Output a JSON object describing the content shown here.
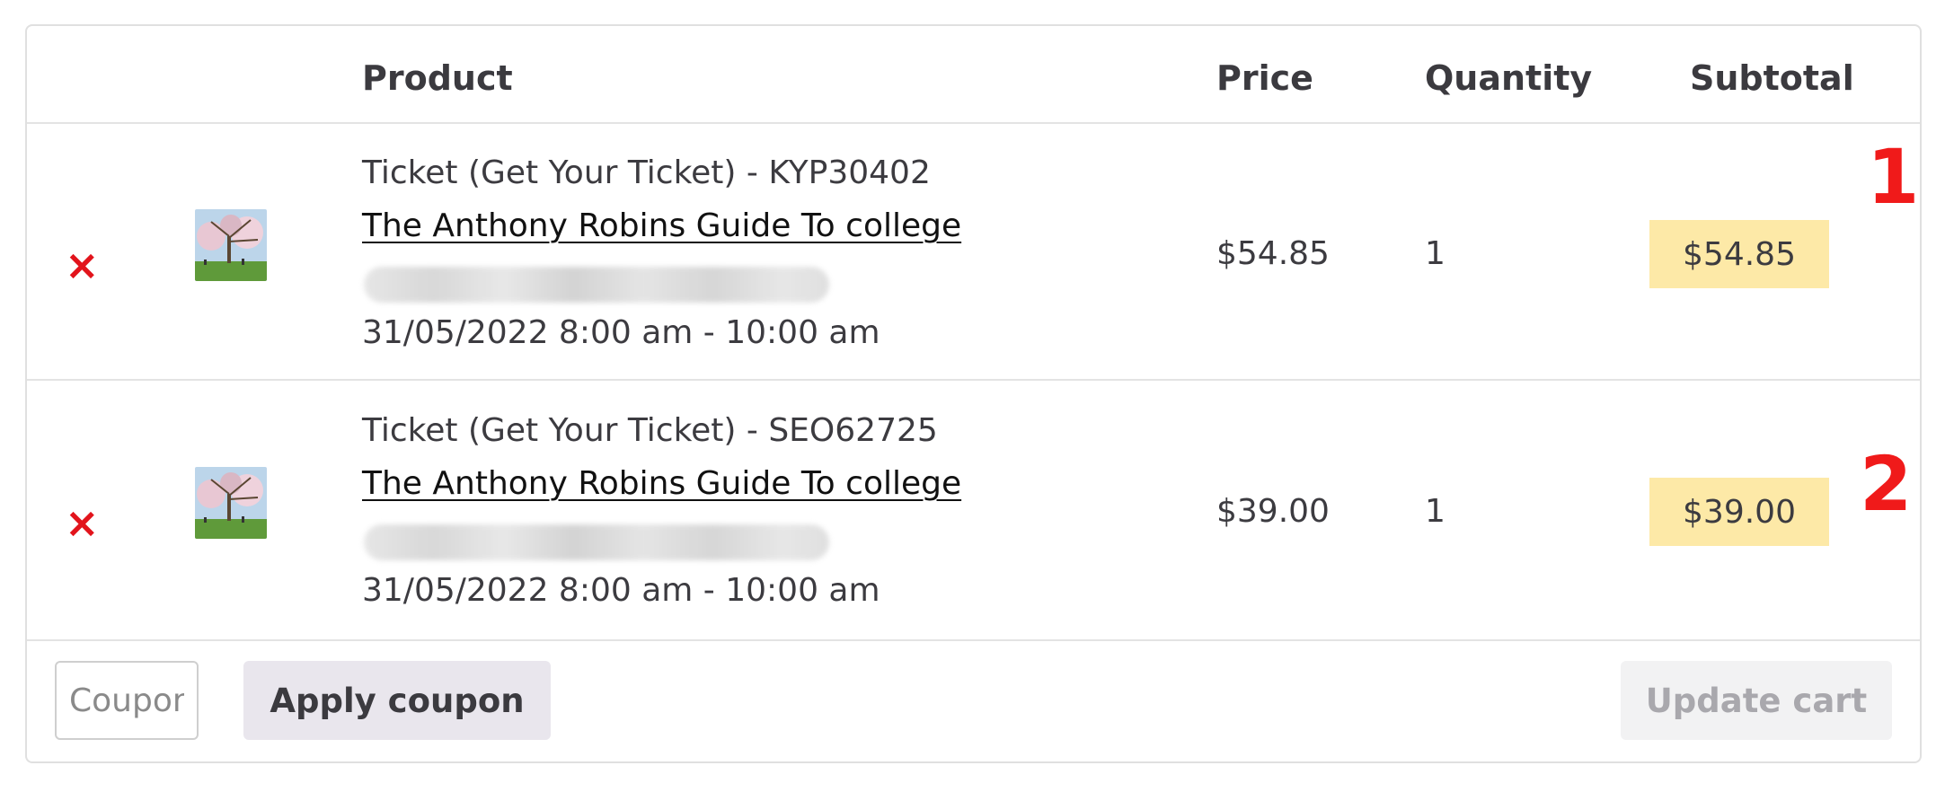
{
  "header": {
    "product": "Product",
    "price": "Price",
    "quantity": "Quantity",
    "subtotal": "Subtotal"
  },
  "rows": [
    {
      "remove_icon": "×",
      "ticket_label": "Ticket (Get Your Ticket) - KYP30402",
      "product_name": "The Anthony Robins Guide To college",
      "datetime": "31/05/2022 8:00 am - 10:00 am",
      "price": "$54.85",
      "quantity": "1",
      "subtotal": "$54.85",
      "annotation": "1"
    },
    {
      "remove_icon": "×",
      "ticket_label": "Ticket (Get Your Ticket) - SEO62725",
      "product_name": "The Anthony Robins Guide To college",
      "datetime": "31/05/2022 8:00 am - 10:00 am",
      "price": "$39.00",
      "quantity": "1",
      "subtotal": "$39.00",
      "annotation": "2"
    }
  ],
  "actions": {
    "coupon_placeholder": "Coupon code",
    "apply_coupon": "Apply coupon",
    "update_cart": "Update cart"
  },
  "colors": {
    "remove": "#e2141c",
    "subtotal_highlight": "#fde9a7",
    "annotation": "#f01a1a"
  },
  "icons": {
    "remove": "close-icon",
    "thumbnail": "product-thumbnail-image"
  }
}
